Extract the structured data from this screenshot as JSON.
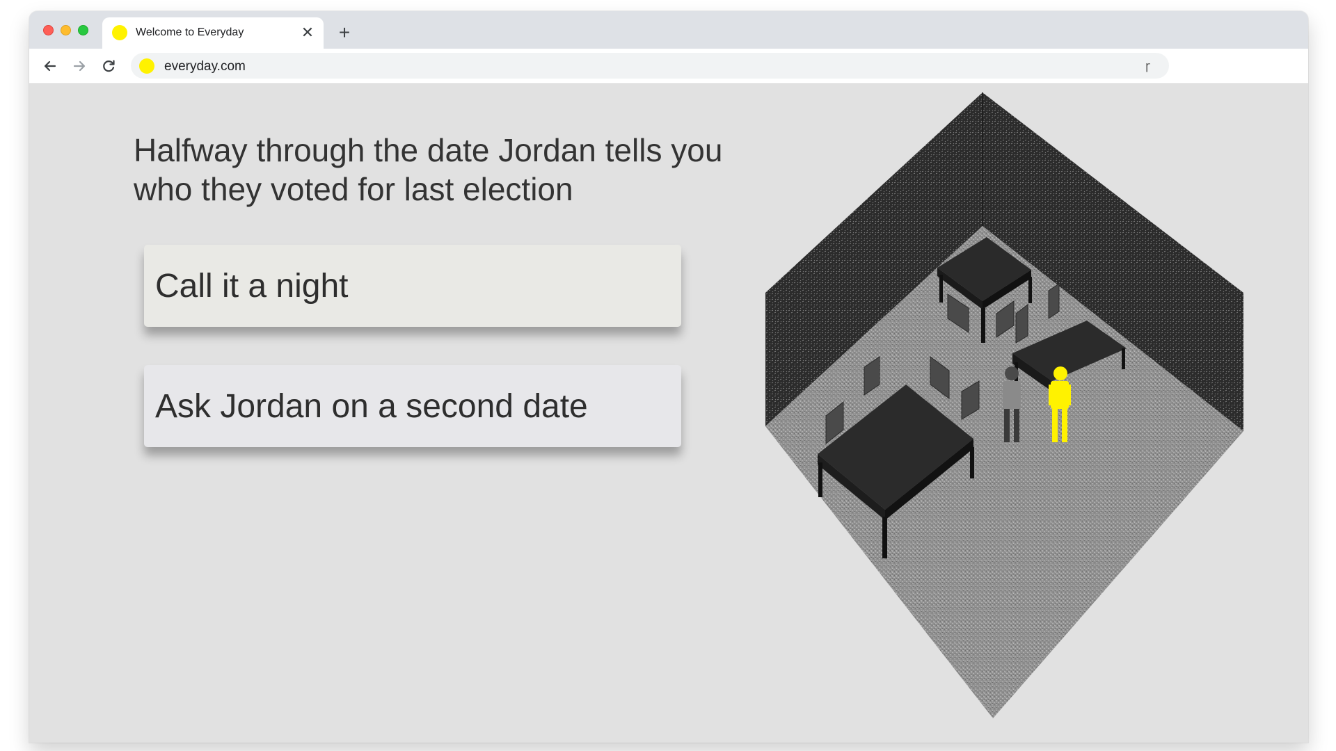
{
  "browser": {
    "tab": {
      "title": "Welcome to Everyday",
      "close_glyph": "✕",
      "favicon_color": "#fff200"
    },
    "new_tab_glyph": "+",
    "url": "everyday.com",
    "extension_glyph": "ɼ"
  },
  "page": {
    "question": "Halfway through the date Jordan tells you who they voted for last election",
    "choices": [
      {
        "label": "Call it a night"
      },
      {
        "label": "Ask Jordan on a second date"
      }
    ]
  },
  "scene": {
    "description_icon": "isometric-restaurant-scene",
    "player_color": "#fff200",
    "other_person_color": "#8a8a8a"
  }
}
